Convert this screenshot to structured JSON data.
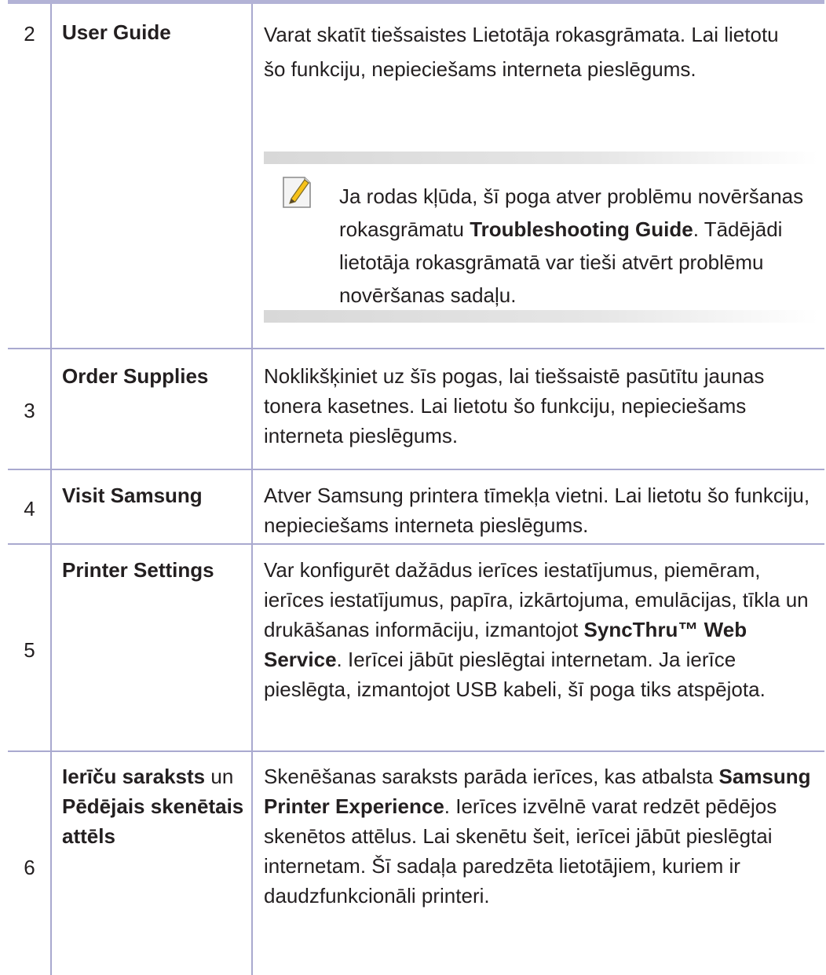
{
  "rows": [
    {
      "num": "2",
      "label": "User Guide",
      "desc": "Varat skatīt tiešsaistes Lietotāja rokasgrāmata. Lai lietotu šo funkciju, nepieciešams interneta pieslēgums.",
      "note": {
        "icon": "note-pencil-icon",
        "text_before": "Ja rodas kļūda, šī poga atver problēmu novēršanas rokasgrāmatu ",
        "bold1": "Troubleshooting Guide",
        "text_after": ". Tādējādi lietotāja rokasgrāmatā var tieši atvērt problēmu novēršanas sadaļu."
      }
    },
    {
      "num": "3",
      "label": "Order Supplies",
      "desc": "Noklikšķiniet uz šīs pogas, lai tiešsaistē pasūtītu jaunas tonera kasetnes. Lai lietotu šo funkciju, nepieciešams interneta pieslēgums."
    },
    {
      "num": "4",
      "label": "Visit Samsung",
      "desc": "Atver Samsung printera tīmekļa vietni. Lai lietotu šo funkciju, nepieciešams interneta pieslēgums."
    },
    {
      "num": "5",
      "label": "Printer Settings",
      "desc_before": "Var konfigurēt dažādus ierīces iestatījumus, piemēram, ierīces iestatījumus, papīra, izkārtojuma, emulācijas, tīkla un drukāšanas informāciju, izmantojot ",
      "desc_bold": "SyncThru™ Web Service",
      "desc_after": ". Ierīcei jābūt pieslēgtai internetam. Ja ierīce pieslēgta, izmantojot USB kabeli, šī poga tiks atspējota."
    },
    {
      "num": "6",
      "label_bold1": "Ierīču saraksts",
      "label_plain": " un ",
      "label_bold2": "Pēdējais skenētais attēls",
      "desc_before": "Skenēšanas saraksts parāda ierīces, kas atbalsta ",
      "desc_bold": "Samsung Printer Experience",
      "desc_after": ". Ierīces izvēlnē varat redzēt pēdējos skenētos attēlus. Lai skenētu šeit, ierīcei jābūt pieslēgtai internetam. Šī sadaļa paredzēta lietotājiem, kuriem ir daudzfunkcionāli printeri."
    }
  ]
}
